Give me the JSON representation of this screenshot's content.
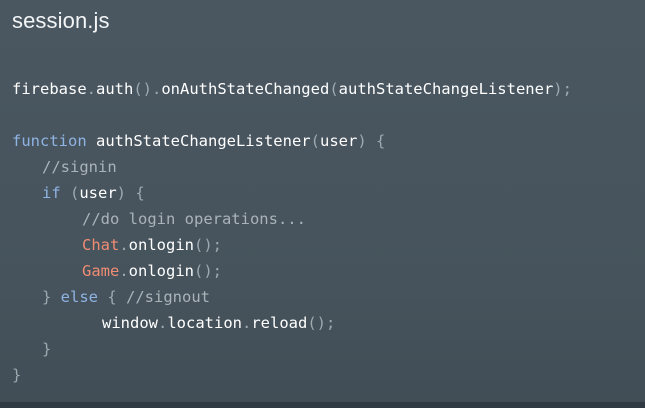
{
  "title": "session.js",
  "code": {
    "line1": {
      "t1": "firebase",
      "t2": ".",
      "t3": "auth",
      "t4": "().",
      "t5": "onAuthStateChanged",
      "t6": "(",
      "t7": "authStateChangeListener",
      "t8": ");"
    },
    "line3": {
      "t1": "function",
      "t2": " ",
      "t3": "authStateChangeListener",
      "t4": "(",
      "t5": "user",
      "t6": ") {"
    },
    "line4": {
      "t1": "//signin"
    },
    "line5": {
      "t1": "if",
      "t2": " (",
      "t3": "user",
      "t4": ") {"
    },
    "line6": {
      "t1": "//do login operations..."
    },
    "line7": {
      "t1": "Chat",
      "t2": ".",
      "t3": "onlogin",
      "t4": "();"
    },
    "line8": {
      "t1": "Game",
      "t2": ".",
      "t3": "onlogin",
      "t4": "();"
    },
    "line9": {
      "t1": "} ",
      "t2": "else",
      "t3": " { ",
      "t4": "//signout"
    },
    "line10": {
      "t1": "window",
      "t2": ".",
      "t3": "location",
      "t4": ".",
      "t5": "reload",
      "t6": "();"
    },
    "line11": {
      "t1": "}"
    },
    "line12": {
      "t1": "}"
    }
  },
  "colors": {
    "background": "#4a5761",
    "identifier": "#ffffff",
    "punctuation": "#9ea8af",
    "keyword": "#8fb3e2",
    "comment": "#aab3b9",
    "class_name": "#f08c73"
  }
}
